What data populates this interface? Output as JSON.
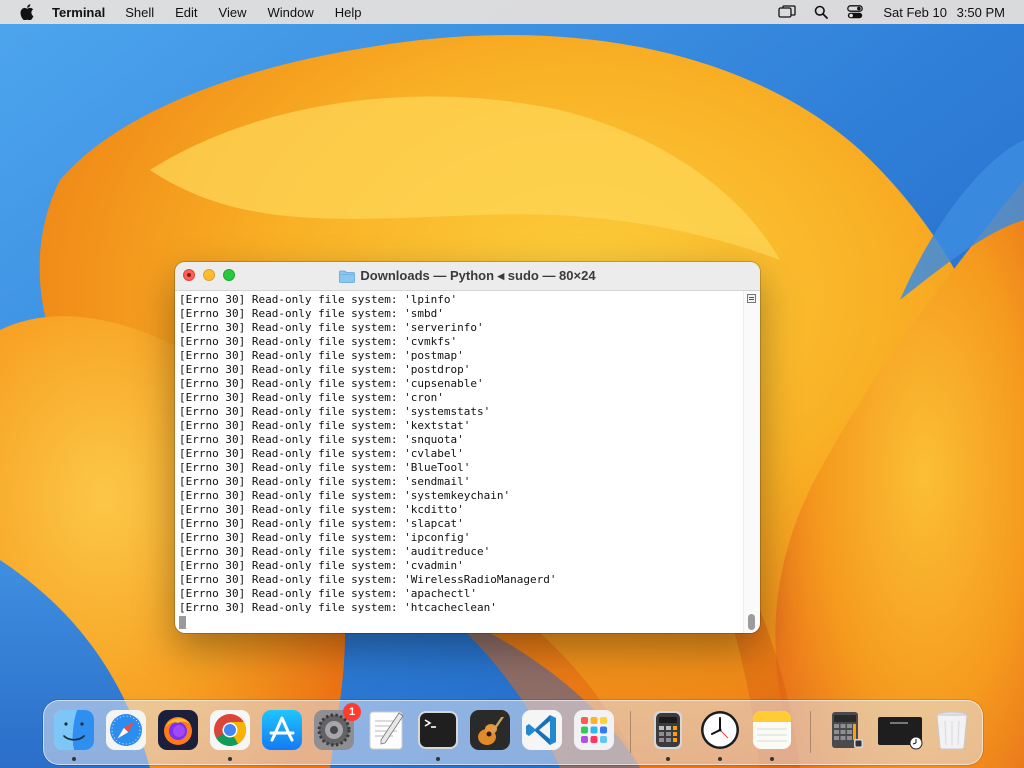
{
  "menubar": {
    "app_name": "Terminal",
    "menus": [
      "Shell",
      "Edit",
      "View",
      "Window",
      "Help"
    ],
    "clock_date": "Sat Feb 10",
    "clock_time": "3:50 PM"
  },
  "terminal": {
    "title": "Downloads — Python ◂ sudo — 80×24",
    "lines": [
      "[Errno 30] Read-only file system: 'lpinfo'",
      "[Errno 30] Read-only file system: 'smbd'",
      "[Errno 30] Read-only file system: 'serverinfo'",
      "[Errno 30] Read-only file system: 'cvmkfs'",
      "[Errno 30] Read-only file system: 'postmap'",
      "[Errno 30] Read-only file system: 'postdrop'",
      "[Errno 30] Read-only file system: 'cupsenable'",
      "[Errno 30] Read-only file system: 'cron'",
      "[Errno 30] Read-only file system: 'systemstats'",
      "[Errno 30] Read-only file system: 'kextstat'",
      "[Errno 30] Read-only file system: 'snquota'",
      "[Errno 30] Read-only file system: 'cvlabel'",
      "[Errno 30] Read-only file system: 'BlueTool'",
      "[Errno 30] Read-only file system: 'sendmail'",
      "[Errno 30] Read-only file system: 'systemkeychain'",
      "[Errno 30] Read-only file system: 'kcditto'",
      "[Errno 30] Read-only file system: 'slapcat'",
      "[Errno 30] Read-only file system: 'ipconfig'",
      "[Errno 30] Read-only file system: 'auditreduce'",
      "[Errno 30] Read-only file system: 'cvadmin'",
      "[Errno 30] Read-only file system: 'WirelessRadioManagerd'",
      "[Errno 30] Read-only file system: 'apachectl'",
      "[Errno 30] Read-only file system: 'htcacheclean'"
    ]
  },
  "dock": {
    "system_settings_badge": "1",
    "apps": [
      {
        "name": "finder-icon",
        "running": true
      },
      {
        "name": "safari-icon",
        "running": false
      },
      {
        "name": "firefox-icon",
        "running": false
      },
      {
        "name": "chrome-icon",
        "running": true
      },
      {
        "name": "app-store-icon",
        "running": false
      },
      {
        "name": "system-settings-icon",
        "running": false
      },
      {
        "name": "textedit-icon",
        "running": false
      },
      {
        "name": "terminal-icon",
        "running": true
      },
      {
        "name": "garageband-icon",
        "running": false
      },
      {
        "name": "vscode-icon",
        "running": false
      },
      {
        "name": "launchpad-icon",
        "running": false
      },
      {
        "name": "calculator-icon",
        "running": true
      },
      {
        "name": "clock-icon",
        "running": true
      },
      {
        "name": "notes-icon",
        "running": true
      }
    ]
  },
  "colors": {
    "accent_orange": "#f6a11c",
    "wallpaper_blue": "#2f7fd8",
    "close": "#fe5f57",
    "minimize": "#febc2e",
    "zoom": "#28c840"
  }
}
